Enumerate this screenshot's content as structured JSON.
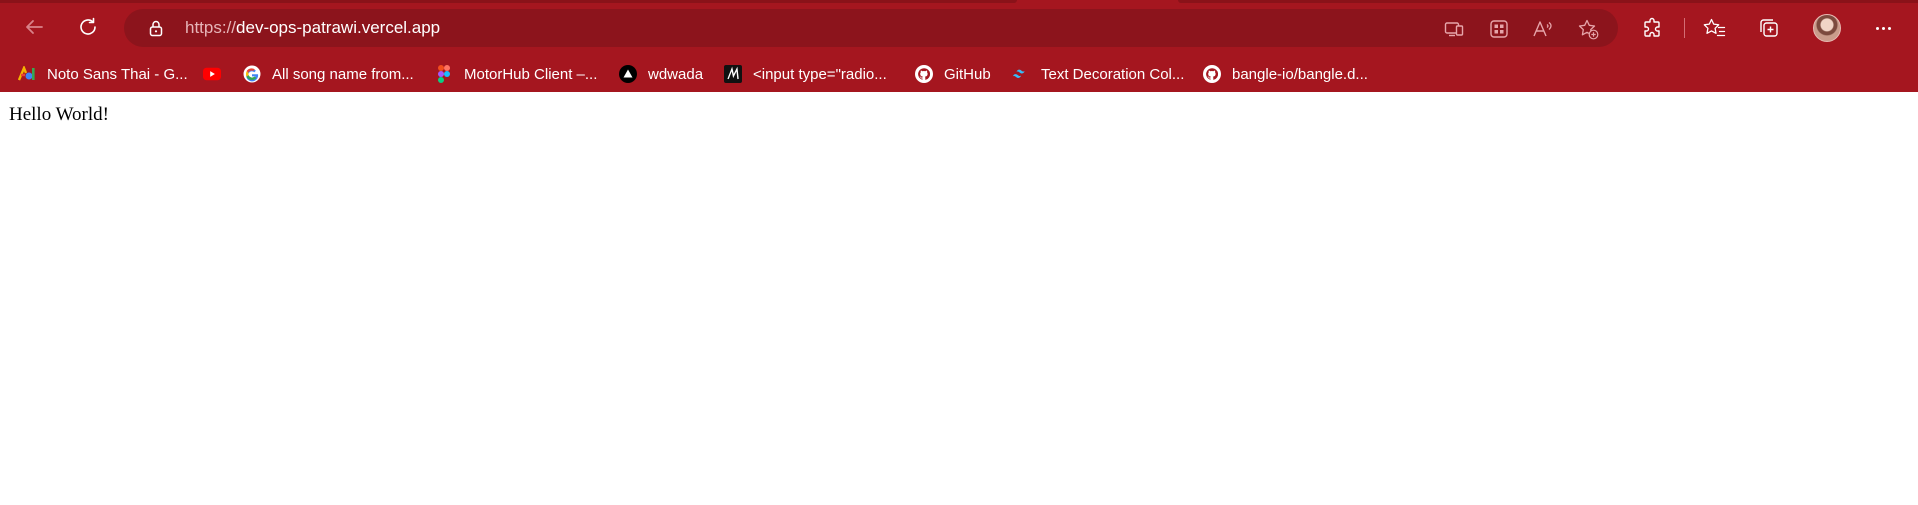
{
  "browser": {
    "url_protocol": "https://",
    "url_host": "dev-ops-patrawi.vercel.app",
    "toolbar_icons": [
      "back-icon",
      "refresh-icon",
      "lock-icon",
      "device-cast-icon",
      "apps-icon",
      "read-aloud-icon",
      "add-favorite-icon",
      "extensions-icon",
      "favorites-icon",
      "collections-icon",
      "profile-avatar",
      "more-icon"
    ],
    "theme_color": "#a5161f"
  },
  "favorites": [
    {
      "label": "Noto Sans Thai - G...",
      "icon": "google-fonts-icon"
    },
    {
      "label": "",
      "icon": "youtube-icon"
    },
    {
      "label": "All song name from...",
      "icon": "google-icon"
    },
    {
      "label": "MotorHub Client –...",
      "icon": "figma-icon"
    },
    {
      "label": "wdwada",
      "icon": "vercel-icon"
    },
    {
      "label": "<input type=\"radio...",
      "icon": "m-logo-icon"
    },
    {
      "label": "GitHub",
      "icon": "github-icon"
    },
    {
      "label": "Text Decoration Col...",
      "icon": "tailwind-icon"
    },
    {
      "label": "bangle-io/bangle.d...",
      "icon": "github-icon"
    }
  ],
  "page": {
    "text": "Hello World!"
  }
}
